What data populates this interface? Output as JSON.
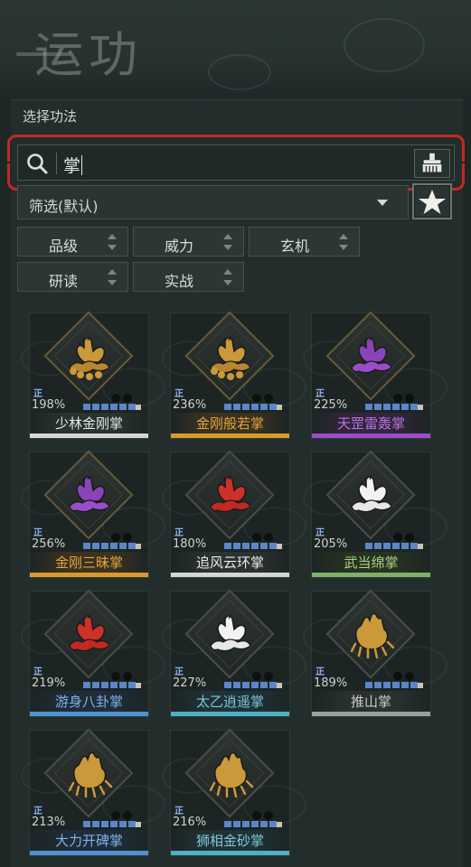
{
  "page": {
    "title": "运功",
    "section_label": "选择功法"
  },
  "search": {
    "value": "掌",
    "clear_icon": "broom-icon",
    "search_icon": "search-icon"
  },
  "filter": {
    "selected": "筛选(默认)",
    "fav_icon": "star-icon"
  },
  "sort_buttons": [
    "品级",
    "威力",
    "玄机",
    "研读",
    "实战"
  ],
  "card_marker": "正",
  "colors": {
    "accent_red": "#c22a1f",
    "gold": "#c9993a",
    "purple": "#8b44b8",
    "red": "#d0302a",
    "white": "#f2f2f2",
    "tan": "#c9993a",
    "blue_bar": "#5b86c8"
  },
  "skills": [
    {
      "name": "少林金刚掌",
      "percent": "198%",
      "color": "gold",
      "name_color": "#e8e8e8",
      "underline": "#d6d6d6",
      "name_bg": "#2a3232"
    },
    {
      "name": "金刚般若掌",
      "percent": "236%",
      "color": "gold",
      "name_color": "#e4a43a",
      "underline": "#d89a2e",
      "name_bg": "#3a3120"
    },
    {
      "name": "天罡雷轰掌",
      "percent": "225%",
      "color": "purple",
      "name_color": "#b873e6",
      "underline": "#9a4dc9",
      "name_bg": "#33253b"
    },
    {
      "name": "金刚三昧掌",
      "percent": "256%",
      "color": "purple",
      "name_color": "#e4a43a",
      "underline": "#d89a2e",
      "name_bg": "#3a3120"
    },
    {
      "name": "追风云环掌",
      "percent": "180%",
      "color": "red",
      "name_color": "#ecebe6",
      "underline": "#d6d6d6",
      "name_bg": "#2a3232"
    },
    {
      "name": "武当绵掌",
      "percent": "205%",
      "color": "white",
      "name_color": "#a8d08a",
      "underline": "#7fb06a",
      "name_bg": "#27321f"
    },
    {
      "name": "游身八卦掌",
      "percent": "219%",
      "color": "red",
      "name_color": "#7eb3e6",
      "underline": "#4f93d0",
      "name_bg": "#1f2c39"
    },
    {
      "name": "太乙逍遥掌",
      "percent": "227%",
      "color": "white",
      "name_color": "#7ec8d8",
      "underline": "#4fb0c8",
      "name_bg": "#1f3236"
    },
    {
      "name": "推山掌",
      "percent": "189%",
      "color": "tan",
      "name_color": "#c8ccc8",
      "underline": "#9aa09c",
      "name_bg": "#2a3030"
    },
    {
      "name": "大力开碑掌",
      "percent": "213%",
      "color": "tan",
      "name_color": "#7eb3e6",
      "underline": "#4f93d0",
      "name_bg": "#1f2c39"
    },
    {
      "name": "狮相金砂掌",
      "percent": "216%",
      "color": "tan",
      "name_color": "#7ec8d8",
      "underline": "#4fb0c8",
      "name_bg": "#1f3236"
    }
  ]
}
